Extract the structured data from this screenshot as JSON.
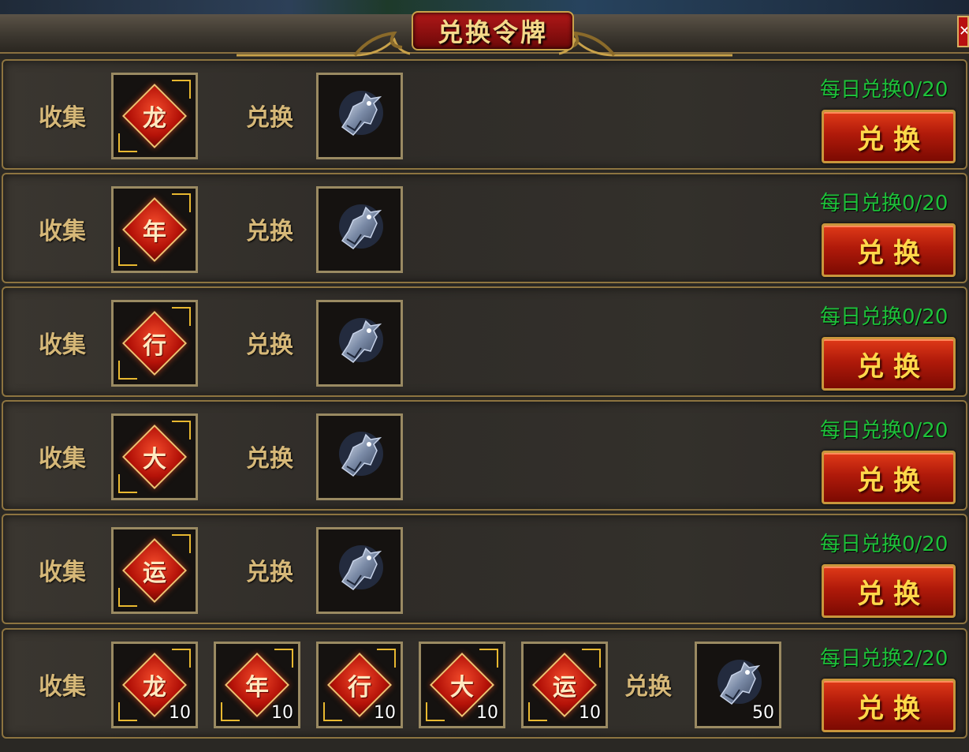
{
  "window": {
    "title": "兑换令牌",
    "close_icon": "close-icon"
  },
  "labels": {
    "collect": "收集",
    "exchange": "兑换",
    "button": "兑换"
  },
  "rows": [
    {
      "collect_items": [
        {
          "char": "龙",
          "count": ""
        }
      ],
      "reward_count": "",
      "daily": "每日兑换0/20"
    },
    {
      "collect_items": [
        {
          "char": "年",
          "count": ""
        }
      ],
      "reward_count": "",
      "daily": "每日兑换0/20"
    },
    {
      "collect_items": [
        {
          "char": "行",
          "count": ""
        }
      ],
      "reward_count": "",
      "daily": "每日兑换0/20"
    },
    {
      "collect_items": [
        {
          "char": "大",
          "count": ""
        }
      ],
      "reward_count": "",
      "daily": "每日兑换0/20"
    },
    {
      "collect_items": [
        {
          "char": "运",
          "count": ""
        }
      ],
      "reward_count": "",
      "daily": "每日兑换0/20"
    },
    {
      "collect_items": [
        {
          "char": "龙",
          "count": "10"
        },
        {
          "char": "年",
          "count": "10"
        },
        {
          "char": "行",
          "count": "10"
        },
        {
          "char": "大",
          "count": "10"
        },
        {
          "char": "运",
          "count": "10"
        }
      ],
      "reward_count": "50",
      "daily": "每日兑换2/20"
    }
  ],
  "colors": {
    "accent_gold": "#c9a24a",
    "daily_green": "#1ec23a",
    "button_red": "#b01a0a",
    "button_text": "#ffd84a"
  },
  "icons": {
    "character_token": "red-diamond-character-icon",
    "reward_token": "silver-token-icon"
  }
}
